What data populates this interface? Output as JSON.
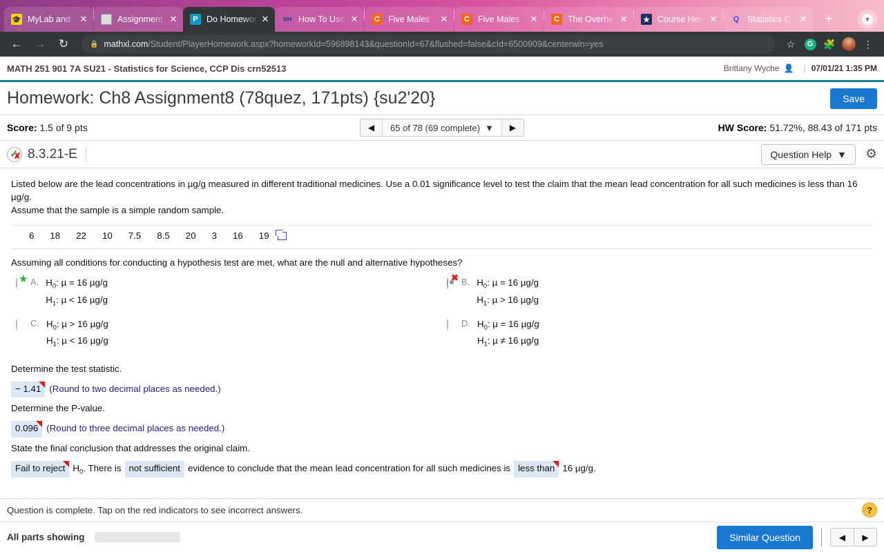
{
  "browser": {
    "tabs": [
      {
        "title": "MyLab and",
        "favicon": "graduation-cap-icon",
        "active": false
      },
      {
        "title": "Assignment",
        "favicon": "document-icon",
        "active": false
      },
      {
        "title": "Do Homework",
        "favicon": "pearson-p-icon",
        "active": true
      },
      {
        "title": "How To Use",
        "favicon": "sh-icon",
        "active": false
      },
      {
        "title": "Five Males",
        "favicon": "chegg-c-icon",
        "active": false
      },
      {
        "title": "Five Males",
        "favicon": "chegg-c-icon",
        "active": false
      },
      {
        "title": "The Overhe",
        "favicon": "chegg-c-icon",
        "active": false
      },
      {
        "title": "Course Her",
        "favicon": "coursehero-shield-icon",
        "active": false
      },
      {
        "title": "Statistics C",
        "favicon": "quizlet-q-icon",
        "active": false
      }
    ],
    "new_tab_label": "+",
    "close_label": "✕",
    "back_icon": "back-arrow-icon",
    "forward_icon": "forward-arrow-icon",
    "reload_icon": "reload-icon",
    "lock_icon": "lock-icon",
    "url_host": "mathxl.com",
    "url_path": "/Student/PlayerHomework.aspx?homeworkId=596898143&questionId=67&flushed=false&cId=6500909&centerwin=yes",
    "star_icon": "bookmark-star-icon",
    "extension_g_label": "G",
    "menu_icon": "kebab-menu-icon"
  },
  "course_bar": {
    "course_title": "MATH 251 901 7A SU21 - Statistics for Science, CCP Dis crn52513",
    "user_name": "Brittany Wyche",
    "person_icon": "person-icon",
    "divider": "|",
    "datetime": "07/01/21 1:35 PM"
  },
  "header": {
    "homework_title": "Homework: Ch8 Assignment8 (78quez, 171pts) {su2'20}",
    "save_label": "Save"
  },
  "score_bar": {
    "score_label": "Score:",
    "score_value": "1.5 of 9 pts",
    "prev_icon": "triangle-left-icon",
    "next_icon": "triangle-right-icon",
    "question_selector": "65 of 78 (69 complete)",
    "caret_icon": "▼",
    "hw_score_label": "HW Score:",
    "hw_score_value": "51.72%, 88.43 of 171 pts"
  },
  "question_header": {
    "status_icon": "partially-correct-icon",
    "check_glyph": "✓",
    "x_glyph": "✘",
    "question_id": "8.3.21-E",
    "question_help_label": "Question Help",
    "question_help_caret": "▼",
    "gear_icon": "gear-icon"
  },
  "question": {
    "stem_line1": "Listed below are the lead concentrations in µg/g measured in different traditional medicines. Use a 0.01 significance level to test the claim that the mean lead concentration for all such medicines is less than 16 µg/g.",
    "stem_line2": "Assume that the sample is a simple random sample.",
    "data_values": [
      "6",
      "18",
      "22",
      "10",
      "7.5",
      "8.5",
      "20",
      "3",
      "16",
      "19"
    ],
    "copy_icon": "copy-data-icon",
    "mc_prompt": "Assuming all conditions for conducting a hypothesis test are met, what are the null and alternative hypotheses?",
    "choices": [
      {
        "letter": "A.",
        "h0": "H₀: µ = 16 µg/g",
        "h1": "H₁: µ < 16 µg/g",
        "selected": false,
        "marker": "star"
      },
      {
        "letter": "B.",
        "h0": "H₀: µ = 16 µg/g",
        "h1": "H₁: µ > 16 µg/g",
        "selected": true,
        "marker": "x"
      },
      {
        "letter": "C.",
        "h0": "H₀: µ > 16 µg/g",
        "h1": "H₁: µ < 16 µg/g",
        "selected": false,
        "marker": "none"
      },
      {
        "letter": "D.",
        "h0": "H₀: µ = 16 µg/g",
        "h1": "H₁: µ ≠ 16 µg/g",
        "selected": false,
        "marker": "none"
      }
    ],
    "test_stat_label": "Determine the test statistic.",
    "test_stat_value": "− 1.41",
    "test_stat_hint": "(Round to two decimal places as needed.)",
    "pvalue_label": "Determine the P-value.",
    "pvalue_value": "0.096",
    "pvalue_hint": "(Round to three decimal places as needed.)",
    "conclusion_label": "State the final conclusion that addresses the original claim.",
    "conclusion_blank1": "Fail to reject",
    "conclusion_mid1": "H₀. There is",
    "conclusion_blank2": "not sufficient",
    "conclusion_mid2": "evidence to conclude that the mean lead concentration for all such medicines is",
    "conclusion_blank3": "less than",
    "conclusion_end": "16 µg/g."
  },
  "footer": {
    "status_note": "Question is complete. Tap on the red indicators to see incorrect answers.",
    "help_bubble": "?",
    "parts_label": "All parts showing",
    "progress_percent": 100,
    "similar_question_label": "Similar Question",
    "prev_icon": "triangle-left-icon",
    "next_icon": "triangle-right-icon"
  },
  "colors": {
    "accent_blue": "#1878d0",
    "teal_rule": "#1a7b9b",
    "answer_box": "#dce6f4",
    "wrong_marker": "#e01b1b",
    "correct_marker": "#22b422"
  }
}
